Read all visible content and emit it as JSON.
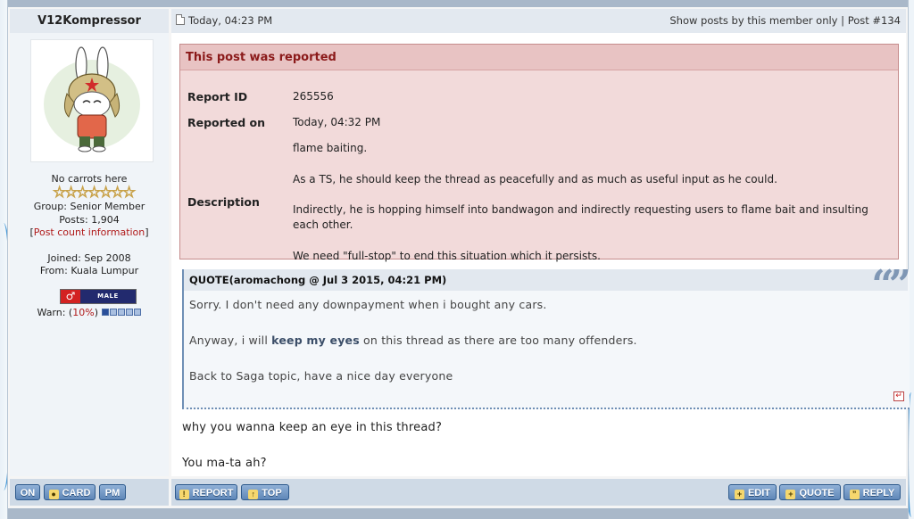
{
  "user": {
    "username": "V12Kompressor",
    "title": "No carrots here",
    "stars": 7,
    "group": "Group: Senior Member",
    "posts": "Posts: 1,904",
    "post_info_open": "[",
    "post_info_link": "Post count information",
    "post_info_close": "]",
    "joined": "Joined: Sep 2008",
    "from": "From: Kuala Lumpur",
    "gender_label": "MALE",
    "gender_symbol": "♂",
    "warn_label": "Warn: (",
    "warn_pct": "10%",
    "warn_close": ")",
    "warn_level": 1,
    "warn_max": 5
  },
  "post": {
    "date": "Today, 04:23 PM",
    "show_posts_link": "Show posts by this member only",
    "separator": "|",
    "post_number": "Post #134"
  },
  "report": {
    "title": "This post was reported",
    "id_label": "Report ID",
    "id_value": "265556",
    "reported_on_label": "Reported on",
    "reported_on_value": "Today, 04:32 PM",
    "description_label": "Description",
    "description_lines": [
      "flame baiting.",
      "As a TS, he should keep the thread as peacefully and as much as useful input as he could.",
      "Indirectly, he is hopping himself into bandwagon and indirectly requesting users to flame bait and insulting each other.",
      "We need \"full-stop\" to end this situation which it persists."
    ]
  },
  "quote": {
    "header": "QUOTE(aromachong @ Jul 3 2015, 04:21 PM)",
    "line1": "Sorry. I don't need any downpayment when i bought any cars.",
    "line2_pre": "Anyway, i will ",
    "line2_bold": "keep my eyes",
    "line2_post": " on this thread as there are too many offenders.",
    "line3": "Back to Saga topic, have a nice day everyone"
  },
  "reply": {
    "line1": "why you wanna keep an eye in this thread?",
    "line2": "You ma-ta ah?"
  },
  "footer": {
    "on": "ON",
    "card": "CARD",
    "pm": "PM",
    "report": "REPORT",
    "top": "TOP",
    "edit": "EDIT",
    "quote": "QUOTE",
    "reply": "REPLY"
  }
}
